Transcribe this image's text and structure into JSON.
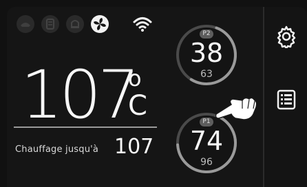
{
  "status_icons": [
    "mode-icon",
    "heater-icon",
    "bell-icon",
    "fan-icon",
    "wifi-icon"
  ],
  "temperature": {
    "value": "107",
    "degree": "o",
    "unit": "C"
  },
  "heating": {
    "label": "Chauffage jusqu'à",
    "target": "107"
  },
  "probes": [
    {
      "id": "P2",
      "current": "38",
      "target": "63",
      "progress": 0.6
    },
    {
      "id": "P1",
      "current": "74",
      "target": "96",
      "progress": 0.77
    }
  ],
  "sidebar": {
    "settings_icon": "gear-icon",
    "menu_icon": "list-icon"
  },
  "colors": {
    "background": "#111111",
    "ring_track": "#4a4a4a",
    "ring_fill": "#9a9a9a",
    "text": "#f7f7f7"
  }
}
